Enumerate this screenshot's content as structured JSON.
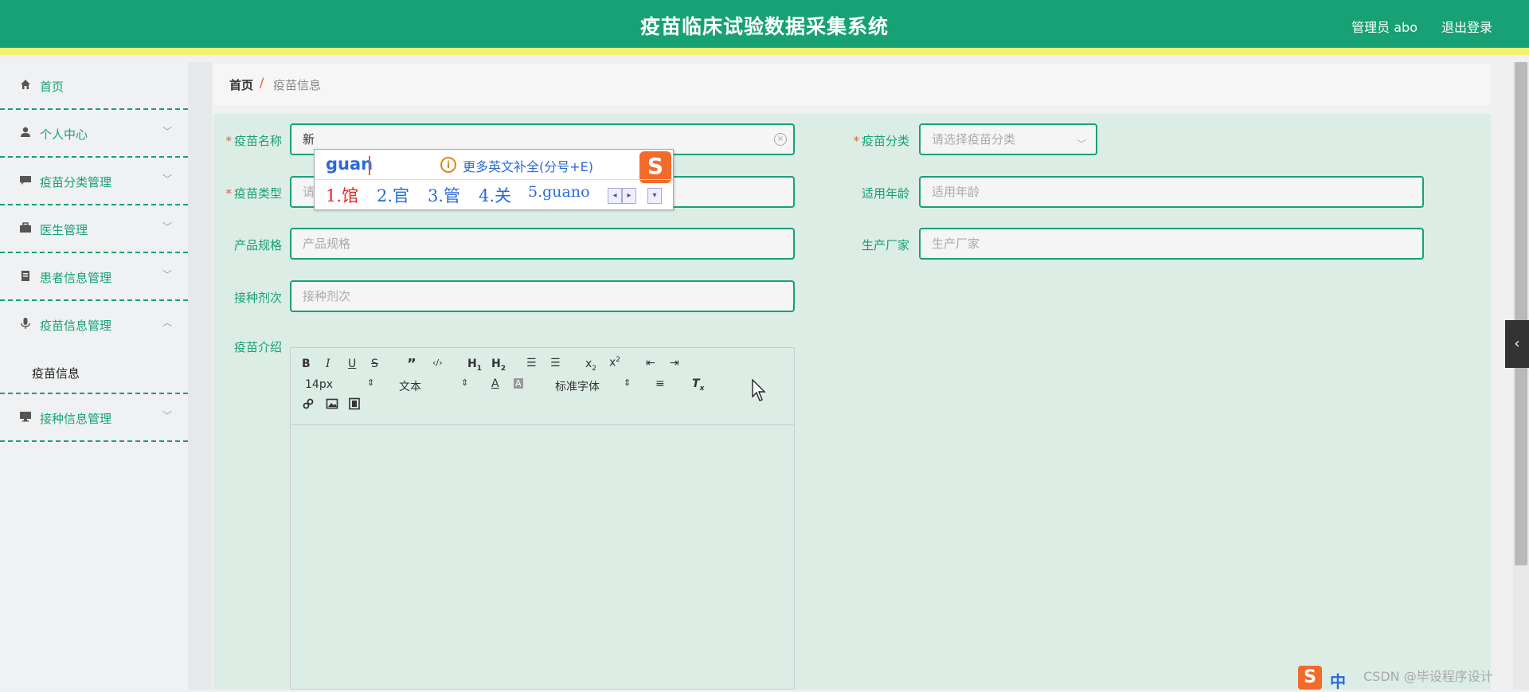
{
  "header": {
    "title": "疫苗临床试验数据采集系统",
    "admin": "管理员 abo",
    "logout": "退出登录"
  },
  "sidebar": {
    "items": [
      {
        "label": "首页",
        "icon": "home-icon"
      },
      {
        "label": "个人中心",
        "icon": "user-icon"
      },
      {
        "label": "疫苗分类管理",
        "icon": "chat-icon"
      },
      {
        "label": "医生管理",
        "icon": "briefcase-icon"
      },
      {
        "label": "患者信息管理",
        "icon": "clipboard-icon"
      },
      {
        "label": "疫苗信息管理",
        "icon": "microphone-icon"
      },
      {
        "label": "接种信息管理",
        "icon": "monitor-icon"
      }
    ],
    "subitem": "疫苗信息"
  },
  "breadcrumb": {
    "home": "首页",
    "sep": "/",
    "current": "疫苗信息"
  },
  "form": {
    "name_label": "疫苗名称",
    "name_value": "新",
    "category_label": "疫苗分类",
    "category_placeholder": "请选择疫苗分类",
    "type_label": "疫苗类型",
    "type_placeholder": "请",
    "age_label": "适用年龄",
    "age_placeholder": "适用年龄",
    "spec_label": "产品规格",
    "spec_placeholder": "产品规格",
    "maker_label": "生产厂家",
    "maker_placeholder": "生产厂家",
    "dose_label": "接种剂次",
    "dose_placeholder": "接种剂次",
    "intro_label": "疫苗介绍"
  },
  "editor": {
    "font_size": "14px",
    "paragraph": "文本",
    "font_family": "标准字体"
  },
  "ime": {
    "typed": "guan",
    "tip": "更多英文补全(分号+E)",
    "candidates": [
      "1.馆",
      "2.官",
      "3.管",
      "4.关",
      "5.guano"
    ]
  },
  "tray": {
    "lang": "中"
  },
  "watermark": "CSDN @毕设程序设计",
  "colors": {
    "primary": "#17a174",
    "accent_bar": "#f2f071",
    "required": "#e05a3a",
    "ime_brand": "#f26b2b"
  }
}
